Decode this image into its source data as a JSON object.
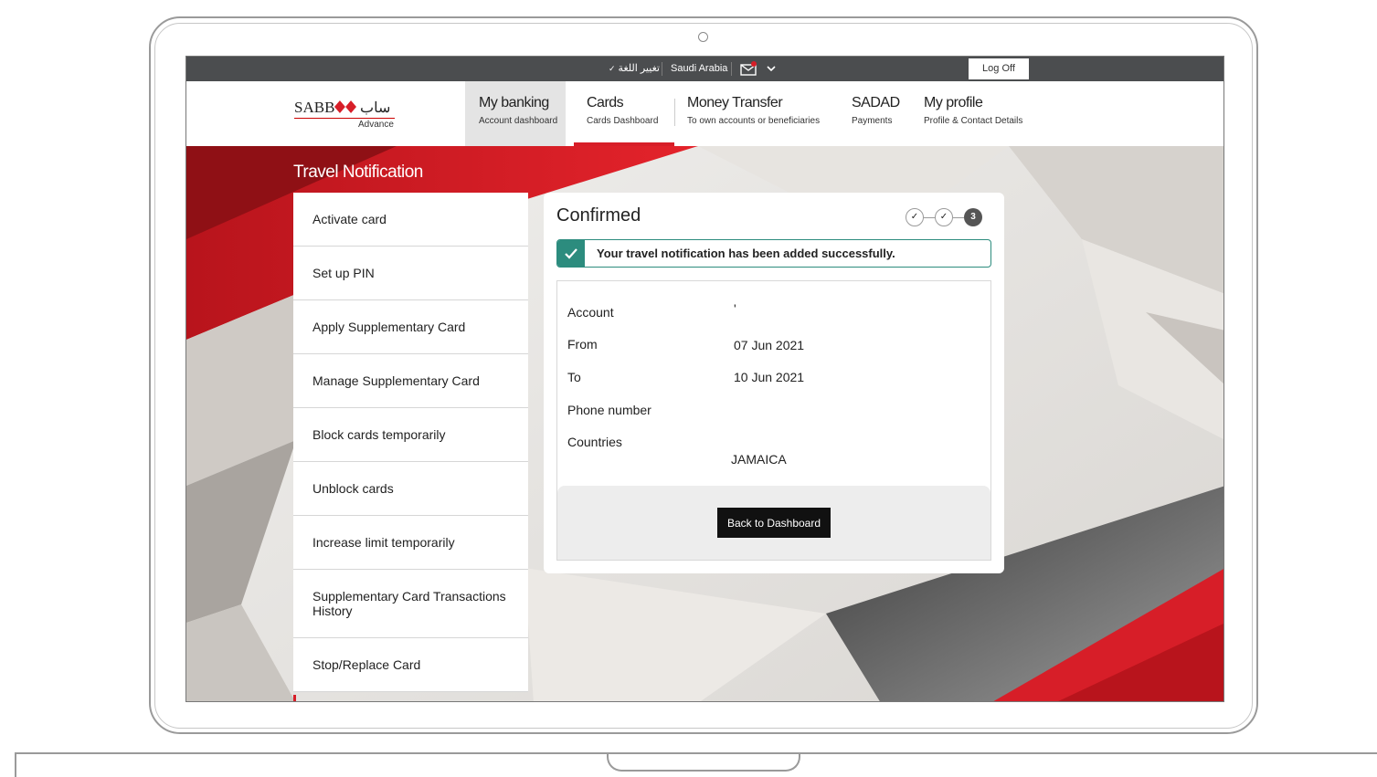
{
  "topbar": {
    "language_label": "تغيير اللغة",
    "country_label": "Saudi Arabia",
    "mail_icon": "mail-icon",
    "logoff_label": "Log Off"
  },
  "logo": {
    "text": "SABB",
    "arabic_text": "ساب",
    "sub_text": "Advance",
    "brand_color": "#d71e28"
  },
  "nav": {
    "items": [
      {
        "title": "My banking",
        "subtitle": "Account dashboard"
      },
      {
        "title": "Cards",
        "subtitle": "Cards Dashboard"
      },
      {
        "title": "Money Transfer",
        "subtitle": "To own accounts or beneficiaries"
      },
      {
        "title": "SADAD",
        "subtitle": "Payments"
      },
      {
        "title": "My profile",
        "subtitle": "Profile & Contact Details"
      }
    ]
  },
  "page": {
    "title": "Travel Notification"
  },
  "sidebar": {
    "items": [
      {
        "label": "Activate card"
      },
      {
        "label": "Set up PIN"
      },
      {
        "label": "Apply Supplementary Card"
      },
      {
        "label": "Manage Supplementary Card"
      },
      {
        "label": "Block cards temporarily"
      },
      {
        "label": "Unblock cards"
      },
      {
        "label": "Increase limit temporarily"
      },
      {
        "label": "Supplementary Card Transactions History"
      },
      {
        "label": "Stop/Replace Card"
      }
    ]
  },
  "confirmation": {
    "title": "Confirmed",
    "steps": {
      "current": "3"
    },
    "success_message": "Your travel notification has been added successfully.",
    "success_color": "#2c8c7e",
    "details": {
      "account_label": "Account",
      "account_value": "'",
      "from_label": "From",
      "from_value": "07 Jun 2021",
      "to_label": "To",
      "to_value": "10 Jun 2021",
      "phone_label": "Phone number",
      "phone_value": "",
      "countries_label": "Countries",
      "countries_value": "JAMAICA"
    },
    "back_button": "Back to Dashboard"
  }
}
